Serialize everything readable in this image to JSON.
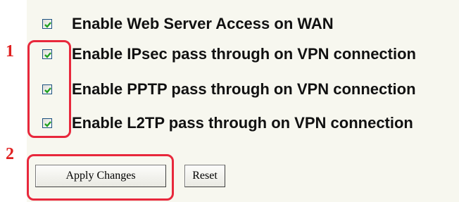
{
  "options": [
    {
      "label": "Enable Web Server Access on WAN",
      "checked": true
    },
    {
      "label": "Enable IPsec pass through on VPN connection",
      "checked": true
    },
    {
      "label": "Enable PPTP pass through on VPN connection",
      "checked": true
    },
    {
      "label": "Enable L2TP pass through on VPN connection",
      "checked": true
    }
  ],
  "callouts": {
    "first": "1",
    "second": "2"
  },
  "buttons": {
    "apply_label": "Apply Changes",
    "reset_label": "Reset"
  },
  "colors": {
    "callout_red": "#e8283c",
    "check_green": "#21a121",
    "panel_bg": "#f7f7ef"
  }
}
